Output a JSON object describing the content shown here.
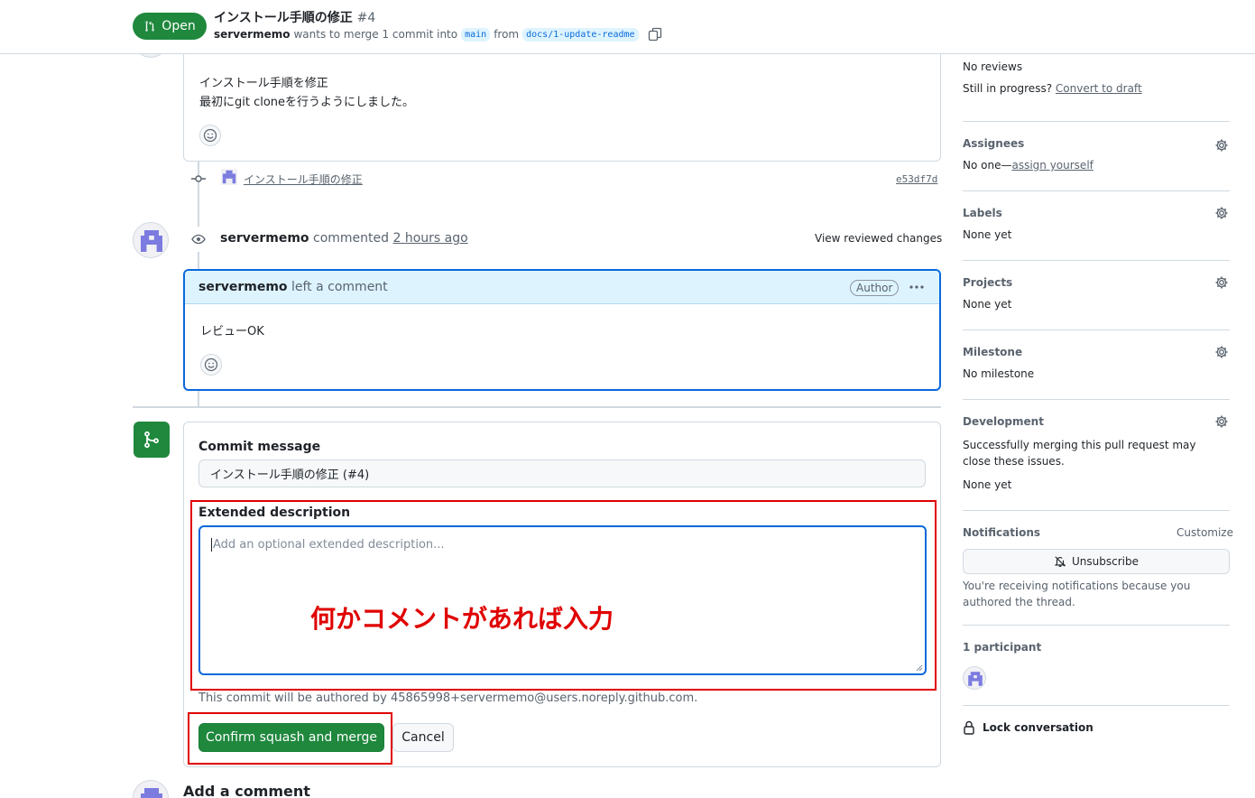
{
  "header": {
    "state": "Open",
    "title": "インストール手順の修正",
    "number": "#4",
    "author": "servermemo",
    "merge_text": "wants to merge 1 commit into",
    "base_branch": "main",
    "from_text": "from",
    "head_branch": "docs/1-update-readme"
  },
  "first_comment": {
    "line1": "インストール手順を修正",
    "line2": "最初にgit cloneを行うようにしました。"
  },
  "commit": {
    "message": "インストール手順の修正",
    "sha": "e53df7d"
  },
  "review": {
    "author": "servermemo",
    "action": "commented",
    "time": "2 hours ago",
    "view_changes": "View reviewed changes",
    "header_author": "servermemo",
    "header_action": "left a comment",
    "badge": "Author",
    "body": "レビューOK"
  },
  "merge_form": {
    "commit_label": "Commit message",
    "commit_value": "インストール手順の修正 (#4)",
    "ext_label": "Extended description",
    "ext_placeholder": "Add an optional extended description...",
    "annotation": "何かコメントがあれば入力",
    "authored_note": "This commit will be authored by 45865998+servermemo@users.noreply.github.com.",
    "confirm_label": "Confirm squash and merge",
    "cancel_label": "Cancel"
  },
  "add_comment_heading": "Add a comment",
  "sidebar": {
    "reviews": {
      "value": "No reviews",
      "progress_text": "Still in progress?",
      "draft_link": "Convert to draft"
    },
    "assignees": {
      "title": "Assignees",
      "prefix": "No one—",
      "link": "assign yourself"
    },
    "labels": {
      "title": "Labels",
      "value": "None yet"
    },
    "projects": {
      "title": "Projects",
      "value": "None yet"
    },
    "milestone": {
      "title": "Milestone",
      "value": "No milestone"
    },
    "development": {
      "title": "Development",
      "desc": "Successfully merging this pull request may close these issues.",
      "value": "None yet"
    },
    "notifications": {
      "title": "Notifications",
      "customize": "Customize",
      "unsubscribe": "Unsubscribe",
      "note": "You're receiving notifications because you authored the thread."
    },
    "participants": {
      "title": "1 participant"
    },
    "lock": {
      "label": "Lock conversation"
    }
  },
  "colors": {
    "open_green": "#1f883d",
    "link_blue": "#0969da",
    "annotation_red": "#e00000",
    "review_header_bg": "#ddf4ff"
  }
}
